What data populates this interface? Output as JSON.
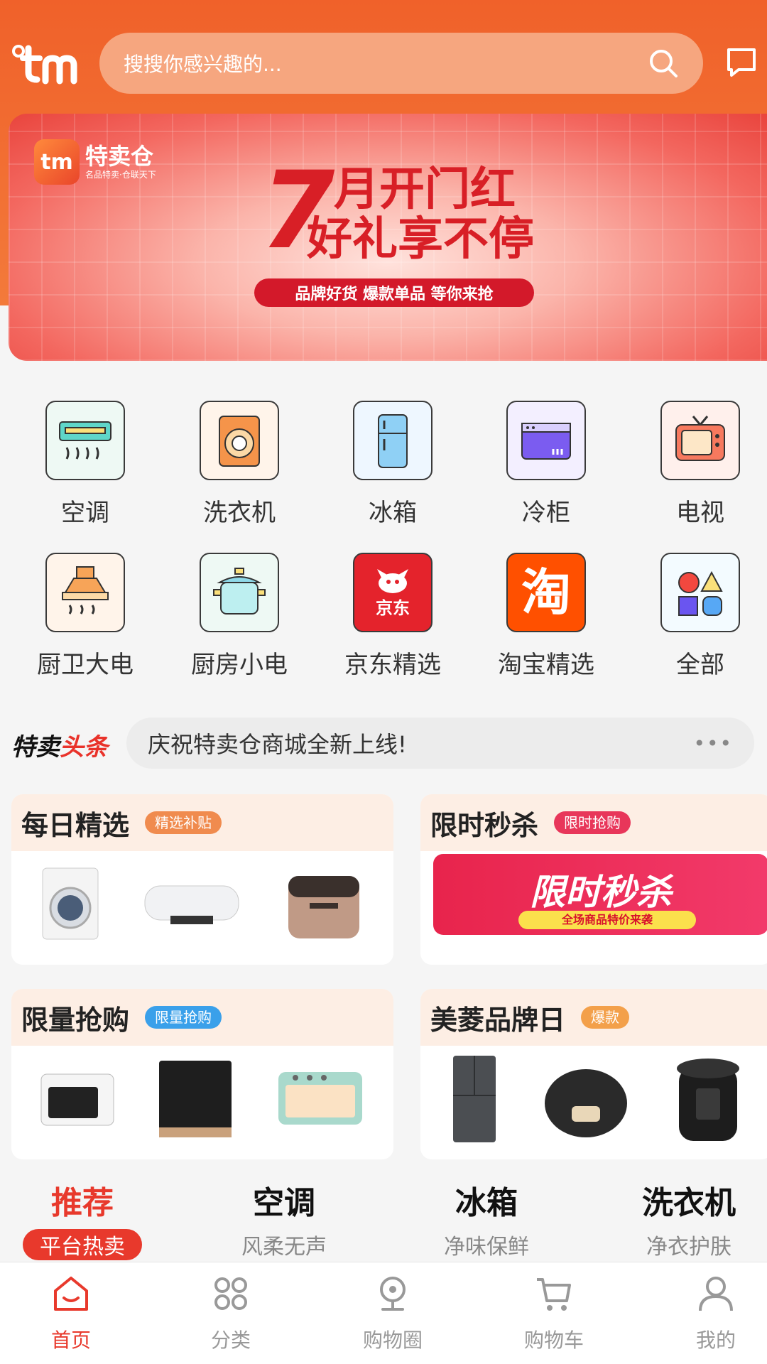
{
  "header": {
    "logo_text": "tm",
    "search_placeholder": "搜搜你感兴趣的...",
    "search_icon": "search-icon",
    "message_icon": "chat-icon"
  },
  "banner": {
    "brand_name": "特卖仓",
    "brand_sub": "名品特卖·仓联天下",
    "big_number": "7",
    "line1": "月开门红",
    "line2": "好礼享不停",
    "pill": "品牌好货 爆款单品 等你来抢"
  },
  "categories": [
    {
      "label": "空调",
      "icon": "air-conditioner-icon"
    },
    {
      "label": "洗衣机",
      "icon": "washing-machine-icon"
    },
    {
      "label": "冰箱",
      "icon": "refrigerator-icon"
    },
    {
      "label": "冷柜",
      "icon": "freezer-icon"
    },
    {
      "label": "电视",
      "icon": "tv-icon"
    },
    {
      "label": "厨卫大电",
      "icon": "range-hood-icon"
    },
    {
      "label": "厨房小电",
      "icon": "pot-icon"
    },
    {
      "label": "京东精选",
      "icon": "jd-icon",
      "icon_text": "京东"
    },
    {
      "label": "淘宝精选",
      "icon": "taobao-icon",
      "icon_text": "淘"
    },
    {
      "label": "全部",
      "icon": "shapes-icon"
    }
  ],
  "news": {
    "title_a": "特卖",
    "title_b": "头条",
    "text": "庆祝特卖仓商城全新上线!",
    "more": "•••"
  },
  "promos": [
    {
      "title": "每日精选",
      "tag": "精选补贴",
      "tag_color": "#f08b4e"
    },
    {
      "title": "限时秒杀",
      "tag": "限时抢购",
      "tag_color": "#e8365a",
      "banner_title": "限时秒杀",
      "banner_sub": "全场商品特价来袭"
    },
    {
      "title": "限量抢购",
      "tag": "限量抢购",
      "tag_color": "#3aa0ea"
    },
    {
      "title": "美菱品牌日",
      "tag": "爆款",
      "tag_color": "#f3a04a"
    }
  ],
  "feature_tabs": [
    {
      "title": "推荐",
      "sub": "平台热卖"
    },
    {
      "title": "空调",
      "sub": "风柔无声"
    },
    {
      "title": "冰箱",
      "sub": "净味保鲜"
    },
    {
      "title": "洗衣机",
      "sub": "净衣护肤"
    }
  ],
  "bottom_nav": [
    {
      "label": "首页",
      "icon": "home-icon"
    },
    {
      "label": "分类",
      "icon": "category-icon"
    },
    {
      "label": "购物圈",
      "icon": "location-icon"
    },
    {
      "label": "购物车",
      "icon": "cart-icon"
    },
    {
      "label": "我的",
      "icon": "user-icon"
    }
  ],
  "colors": {
    "brand": "#f0612a",
    "accent": "#e8392c"
  }
}
